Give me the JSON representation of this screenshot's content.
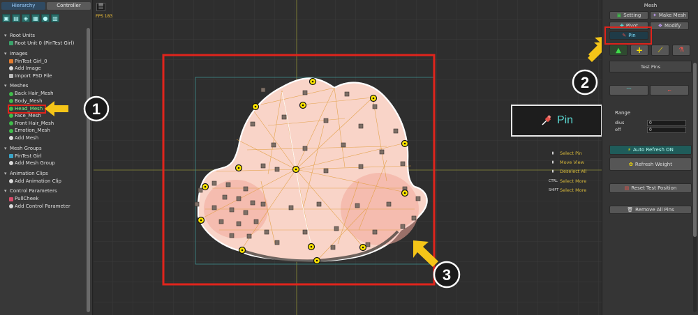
{
  "left_panel": {
    "tabs": [
      "Hierarchy",
      "Controller"
    ],
    "sections": [
      {
        "title": "Root Units",
        "items": [
          {
            "label": "Root Unit 0 (PinTest Girl)",
            "icon": "unit-icon"
          }
        ]
      },
      {
        "title": "Images",
        "items": [
          {
            "label": "PinTest Girl_0",
            "icon": "image-icon"
          },
          {
            "label": "Add Image",
            "icon": "add-icon"
          },
          {
            "label": "Import PSD File",
            "icon": "import-icon"
          }
        ]
      },
      {
        "title": "Meshes",
        "items": [
          {
            "label": "Back Hair_Mesh",
            "icon": "mesh-icon"
          },
          {
            "label": "Body_Mesh",
            "icon": "mesh-icon"
          },
          {
            "label": "Head_Mesh",
            "icon": "mesh-icon"
          },
          {
            "label": "Face_Mesh",
            "icon": "mesh-icon"
          },
          {
            "label": "Front Hair_Mesh",
            "icon": "mesh-icon"
          },
          {
            "label": "Emotion_Mesh",
            "icon": "mesh-icon"
          },
          {
            "label": "Add Mesh",
            "icon": "add-icon"
          }
        ]
      },
      {
        "title": "Mesh Groups",
        "items": [
          {
            "label": "PinTest Girl",
            "icon": "group-icon"
          },
          {
            "label": "Add Mesh Group",
            "icon": "add-icon"
          }
        ]
      },
      {
        "title": "Animation Clips",
        "items": [
          {
            "label": "Add Animation Clip",
            "icon": "add-icon"
          }
        ]
      },
      {
        "title": "Control Parameters",
        "items": [
          {
            "label": "PullCheek",
            "icon": "param-icon"
          },
          {
            "label": "Add Control Parameter",
            "icon": "add-icon"
          }
        ]
      }
    ]
  },
  "canvas": {
    "menu_glyph": "☰",
    "fps": "FPS 183",
    "legend": [
      {
        "key": "",
        "label": "Select Pin"
      },
      {
        "key": "",
        "label": "Move View"
      },
      {
        "key": "",
        "label": "Deselect All"
      },
      {
        "key": "CTRL",
        "label": "Select More"
      },
      {
        "key": "SHIFT",
        "label": "Select More"
      }
    ],
    "callout_label": "Pin",
    "steps": [
      "1",
      "2",
      "3"
    ]
  },
  "right_panel": {
    "title": "Mesh",
    "tabs": {
      "setting": "Setting",
      "make_mesh": "Make Mesh",
      "pivot": "Pivot",
      "modify": "Modify",
      "pin": "Pin"
    },
    "test_pins": "Test Pins",
    "range_label": "Range",
    "radius_label": "dius",
    "radius_value": "0",
    "falloff_label": "off",
    "falloff_value": "0",
    "auto_refresh": "Auto Refresh ON",
    "refresh_weight": "Refresh Weight",
    "reset_test_position": "Reset Test Position",
    "remove_all_pins": "Remove All Pins"
  },
  "colors": {
    "highlight_red": "#e0241c",
    "arrow_yellow": "#f5c518",
    "pin_yellow": "#ffe600",
    "mesh_fill": "#f9cfc4",
    "accent_teal": "#5ad6d0"
  }
}
